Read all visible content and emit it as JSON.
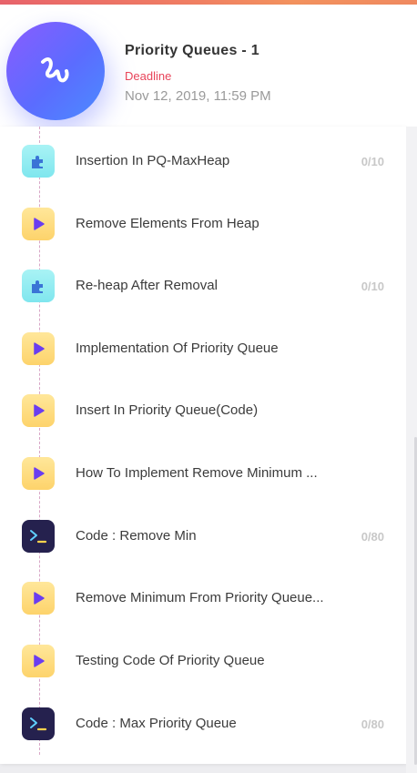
{
  "header": {
    "title": "Priority Queues - 1",
    "deadline_label": "Deadline",
    "deadline_date": "Nov 12, 2019, 11:59 PM",
    "logo_icon": "squiggle-logo-icon"
  },
  "items": [
    {
      "label": "Insertion In PQ-MaxHeap",
      "score": "0/10",
      "icon": "puzzle-icon"
    },
    {
      "label": "Remove Elements From Heap",
      "score": "",
      "icon": "play-icon"
    },
    {
      "label": "Re-heap After Removal",
      "score": "0/10",
      "icon": "puzzle-icon"
    },
    {
      "label": "Implementation Of Priority Queue",
      "score": "",
      "icon": "play-icon"
    },
    {
      "label": "Insert In Priority Queue(Code)",
      "score": "",
      "icon": "play-icon"
    },
    {
      "label": "How To Implement Remove Minimum ...",
      "score": "",
      "icon": "play-icon"
    },
    {
      "label": "Code : Remove Min",
      "score": "0/80",
      "icon": "terminal-icon"
    },
    {
      "label": "Remove Minimum From Priority Queue...",
      "score": "",
      "icon": "play-icon"
    },
    {
      "label": "Testing Code Of Priority Queue",
      "score": "",
      "icon": "play-icon"
    },
    {
      "label": "Code : Max Priority Queue",
      "score": "0/80",
      "icon": "terminal-icon"
    }
  ],
  "colors": {
    "accent": "#5b6cff",
    "deadline": "#e8445a",
    "play": "#6a3df0",
    "puzzle": "#3a74d6",
    "terminal_bg": "#25214e"
  }
}
